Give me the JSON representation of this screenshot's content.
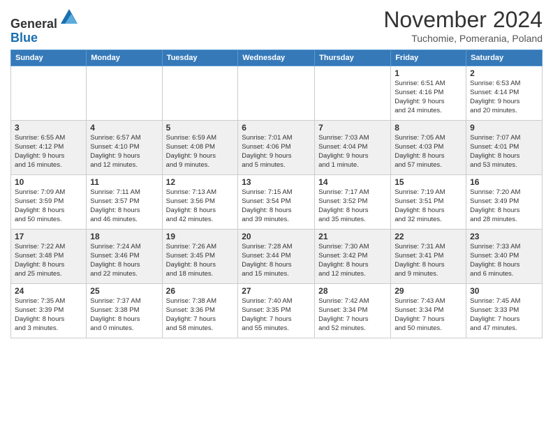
{
  "logo": {
    "general": "General",
    "blue": "Blue"
  },
  "title": "November 2024",
  "subtitle": "Tuchomie, Pomerania, Poland",
  "headers": [
    "Sunday",
    "Monday",
    "Tuesday",
    "Wednesday",
    "Thursday",
    "Friday",
    "Saturday"
  ],
  "weeks": [
    [
      {
        "day": "",
        "info": ""
      },
      {
        "day": "",
        "info": ""
      },
      {
        "day": "",
        "info": ""
      },
      {
        "day": "",
        "info": ""
      },
      {
        "day": "",
        "info": ""
      },
      {
        "day": "1",
        "info": "Sunrise: 6:51 AM\nSunset: 4:16 PM\nDaylight: 9 hours\nand 24 minutes."
      },
      {
        "day": "2",
        "info": "Sunrise: 6:53 AM\nSunset: 4:14 PM\nDaylight: 9 hours\nand 20 minutes."
      }
    ],
    [
      {
        "day": "3",
        "info": "Sunrise: 6:55 AM\nSunset: 4:12 PM\nDaylight: 9 hours\nand 16 minutes."
      },
      {
        "day": "4",
        "info": "Sunrise: 6:57 AM\nSunset: 4:10 PM\nDaylight: 9 hours\nand 12 minutes."
      },
      {
        "day": "5",
        "info": "Sunrise: 6:59 AM\nSunset: 4:08 PM\nDaylight: 9 hours\nand 9 minutes."
      },
      {
        "day": "6",
        "info": "Sunrise: 7:01 AM\nSunset: 4:06 PM\nDaylight: 9 hours\nand 5 minutes."
      },
      {
        "day": "7",
        "info": "Sunrise: 7:03 AM\nSunset: 4:04 PM\nDaylight: 9 hours\nand 1 minute."
      },
      {
        "day": "8",
        "info": "Sunrise: 7:05 AM\nSunset: 4:03 PM\nDaylight: 8 hours\nand 57 minutes."
      },
      {
        "day": "9",
        "info": "Sunrise: 7:07 AM\nSunset: 4:01 PM\nDaylight: 8 hours\nand 53 minutes."
      }
    ],
    [
      {
        "day": "10",
        "info": "Sunrise: 7:09 AM\nSunset: 3:59 PM\nDaylight: 8 hours\nand 50 minutes."
      },
      {
        "day": "11",
        "info": "Sunrise: 7:11 AM\nSunset: 3:57 PM\nDaylight: 8 hours\nand 46 minutes."
      },
      {
        "day": "12",
        "info": "Sunrise: 7:13 AM\nSunset: 3:56 PM\nDaylight: 8 hours\nand 42 minutes."
      },
      {
        "day": "13",
        "info": "Sunrise: 7:15 AM\nSunset: 3:54 PM\nDaylight: 8 hours\nand 39 minutes."
      },
      {
        "day": "14",
        "info": "Sunrise: 7:17 AM\nSunset: 3:52 PM\nDaylight: 8 hours\nand 35 minutes."
      },
      {
        "day": "15",
        "info": "Sunrise: 7:19 AM\nSunset: 3:51 PM\nDaylight: 8 hours\nand 32 minutes."
      },
      {
        "day": "16",
        "info": "Sunrise: 7:20 AM\nSunset: 3:49 PM\nDaylight: 8 hours\nand 28 minutes."
      }
    ],
    [
      {
        "day": "17",
        "info": "Sunrise: 7:22 AM\nSunset: 3:48 PM\nDaylight: 8 hours\nand 25 minutes."
      },
      {
        "day": "18",
        "info": "Sunrise: 7:24 AM\nSunset: 3:46 PM\nDaylight: 8 hours\nand 22 minutes."
      },
      {
        "day": "19",
        "info": "Sunrise: 7:26 AM\nSunset: 3:45 PM\nDaylight: 8 hours\nand 18 minutes."
      },
      {
        "day": "20",
        "info": "Sunrise: 7:28 AM\nSunset: 3:44 PM\nDaylight: 8 hours\nand 15 minutes."
      },
      {
        "day": "21",
        "info": "Sunrise: 7:30 AM\nSunset: 3:42 PM\nDaylight: 8 hours\nand 12 minutes."
      },
      {
        "day": "22",
        "info": "Sunrise: 7:31 AM\nSunset: 3:41 PM\nDaylight: 8 hours\nand 9 minutes."
      },
      {
        "day": "23",
        "info": "Sunrise: 7:33 AM\nSunset: 3:40 PM\nDaylight: 8 hours\nand 6 minutes."
      }
    ],
    [
      {
        "day": "24",
        "info": "Sunrise: 7:35 AM\nSunset: 3:39 PM\nDaylight: 8 hours\nand 3 minutes."
      },
      {
        "day": "25",
        "info": "Sunrise: 7:37 AM\nSunset: 3:38 PM\nDaylight: 8 hours\nand 0 minutes."
      },
      {
        "day": "26",
        "info": "Sunrise: 7:38 AM\nSunset: 3:36 PM\nDaylight: 7 hours\nand 58 minutes."
      },
      {
        "day": "27",
        "info": "Sunrise: 7:40 AM\nSunset: 3:35 PM\nDaylight: 7 hours\nand 55 minutes."
      },
      {
        "day": "28",
        "info": "Sunrise: 7:42 AM\nSunset: 3:34 PM\nDaylight: 7 hours\nand 52 minutes."
      },
      {
        "day": "29",
        "info": "Sunrise: 7:43 AM\nSunset: 3:34 PM\nDaylight: 7 hours\nand 50 minutes."
      },
      {
        "day": "30",
        "info": "Sunrise: 7:45 AM\nSunset: 3:33 PM\nDaylight: 7 hours\nand 47 minutes."
      }
    ]
  ]
}
